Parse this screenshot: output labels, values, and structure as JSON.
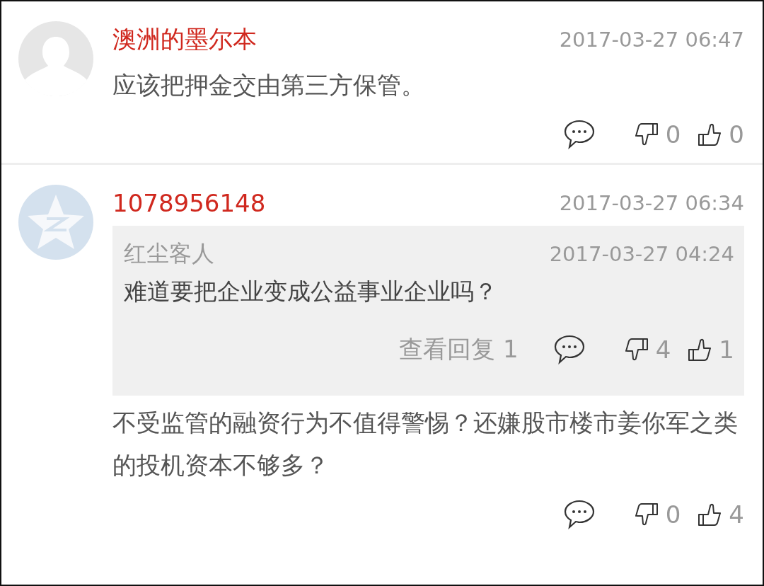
{
  "comments": [
    {
      "avatar": {
        "kind": "default"
      },
      "name": "澳洲的墨尔本",
      "time": "2017-03-27 06:47",
      "text": "应该把押金交由第三方保管。",
      "dislikes": "0",
      "likes": "0"
    },
    {
      "avatar": {
        "kind": "star"
      },
      "name": "1078956148",
      "time": "2017-03-27 06:34",
      "quote": {
        "name": "红尘客人",
        "time": "2017-03-27 04:24",
        "text": "难道要把企业变成公益事业企业吗？",
        "view_replies": "查看回复 1",
        "dislikes": "4",
        "likes": "1"
      },
      "text": "不受监管的融资行为不值得警惕？还嫌股市楼市姜你军之类的投机资本不够多？",
      "dislikes": "0",
      "likes": "4"
    }
  ]
}
